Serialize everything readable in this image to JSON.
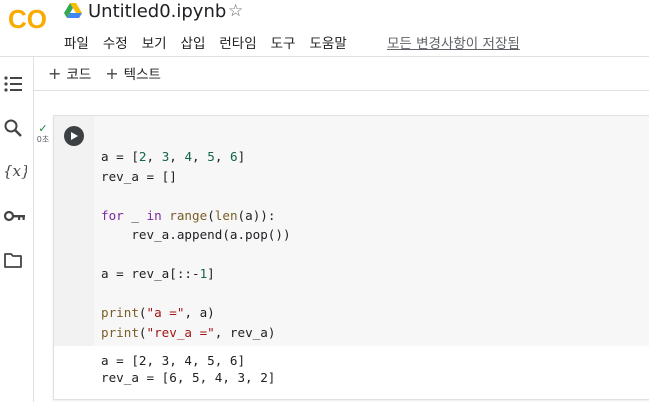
{
  "header": {
    "logo_text": "CO",
    "notebook_title": "Untitled0.ipynb",
    "menu": [
      "파일",
      "수정",
      "보기",
      "삽입",
      "런타임",
      "도구",
      "도움말"
    ],
    "save_status": "모든 변경사항이 저장됨"
  },
  "toolbar": {
    "add_code": "코드",
    "add_text": "텍스트"
  },
  "rail": {
    "icons": [
      "toc-icon",
      "search-icon",
      "variables-icon",
      "secrets-key-icon",
      "folder-icon"
    ]
  },
  "cell": {
    "exec_time": "0초",
    "code_lines": [
      "a = [2, 3, 4, 5, 6]",
      "rev_a = []",
      "",
      "for _ in range(len(a)):",
      "    rev_a.append(a.pop())",
      "",
      "a = rev_a[::-1]",
      "",
      "print(\"a =\", a)",
      "print(\"rev_a =\", rev_a)"
    ],
    "output_lines": [
      "a = [2, 3, 4, 5, 6]",
      "rev_a = [6, 5, 4, 3, 2]"
    ]
  },
  "colors": {
    "logo_orange": "#f9ab00",
    "logo_dark_orange": "#e37400",
    "keyword": "#7928a1",
    "string": "#a31515",
    "number": "#116644",
    "check_green": "#188038"
  }
}
